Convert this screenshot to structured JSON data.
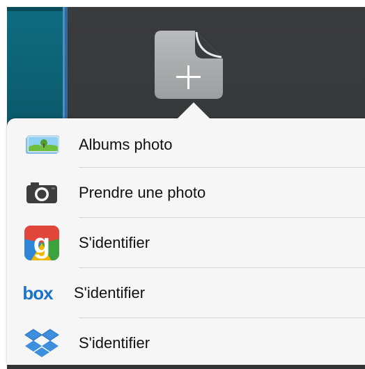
{
  "menu": {
    "items": [
      {
        "id": "photo-albums",
        "label": "Albums photo",
        "icon": "photos-icon"
      },
      {
        "id": "take-photo",
        "label": "Prendre une photo",
        "icon": "camera-icon"
      },
      {
        "id": "google",
        "label": "S'identifier",
        "icon": "google-icon"
      },
      {
        "id": "box",
        "label": "S'identifier",
        "icon": "box-icon",
        "logo_text": "box"
      },
      {
        "id": "dropbox",
        "label": "S'identifier",
        "icon": "dropbox-icon"
      }
    ]
  },
  "colors": {
    "backdrop": "#353638",
    "popover": "#f6f6f6",
    "box_blue": "#1b73c7",
    "dropbox_blue": "#3d8fdd",
    "side_panel": "#0f6d80"
  }
}
